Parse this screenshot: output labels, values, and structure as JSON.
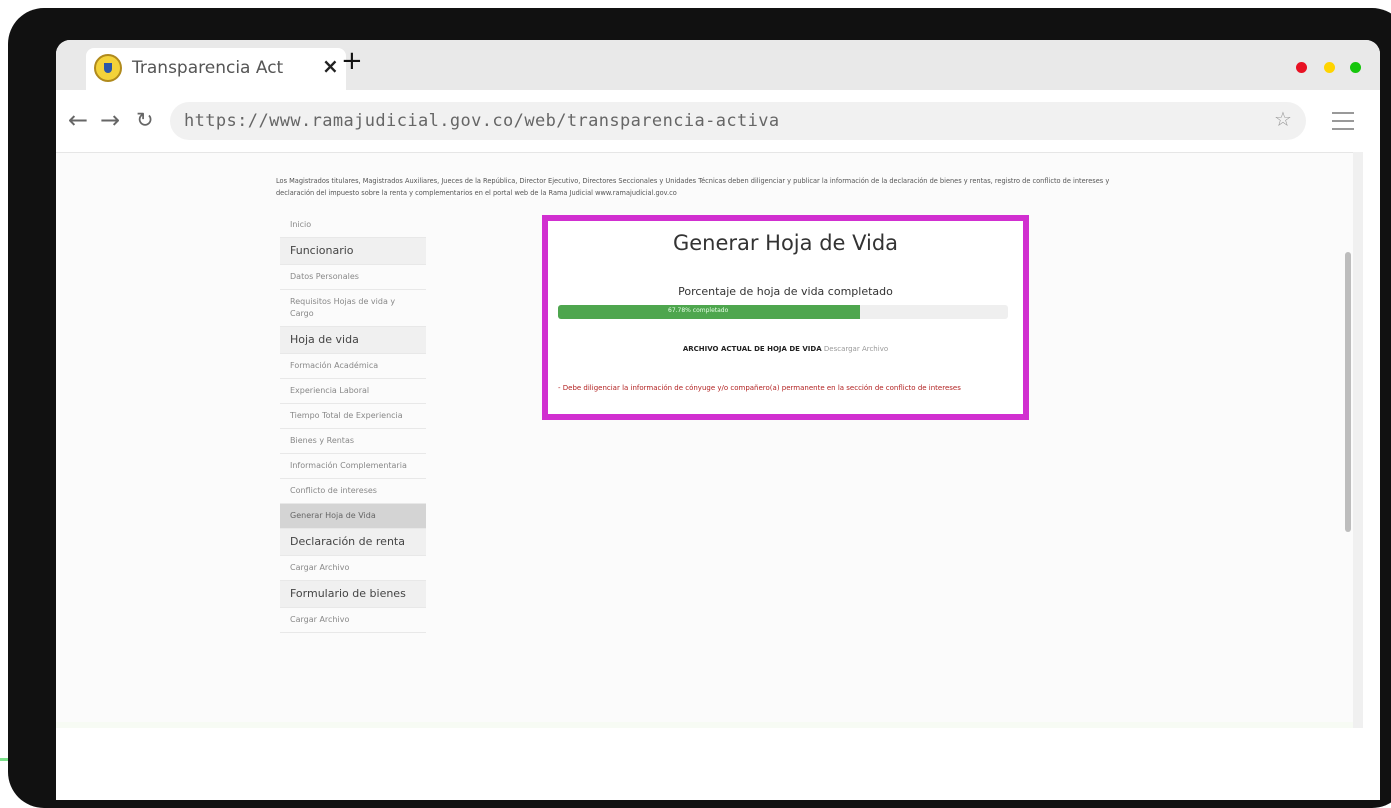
{
  "browser": {
    "tab_title": "Transparencia Act",
    "tab_close": "×",
    "new_tab": "+",
    "url": "https://www.ramajudicial.gov.co/web/transparencia-activa",
    "window_dots": [
      "#e81123",
      "#ffd400",
      "#16c60c"
    ]
  },
  "page": {
    "intro": "Los Magistrados titulares, Magistrados Auxiliares, Jueces de la República, Director Ejecutivo, Directores Seccionales y Unidades Técnicas deben diligenciar y publicar la información de la declaración de bienes y rentas, registro de conflicto de intereses y declaración del impuesto sobre la renta y complementarios en el portal web de la Rama Judicial www.ramajudicial.gov.co",
    "sidebar": {
      "inicio": "Inicio",
      "funcionario": "Funcionario",
      "datos_personales": "Datos Personales",
      "requisitos": "Requisitos Hojas de vida y Cargo",
      "hoja_de_vida": "Hoja de vida",
      "formacion": "Formación Académica",
      "experiencia": "Experiencia Laboral",
      "tiempo_total": "Tiempo Total de Experiencia",
      "bienes": "Bienes y Rentas",
      "informacion": "Información Complementaria",
      "conflicto": "Conflicto de intereses",
      "generar": "Generar Hoja de Vida",
      "declaracion": "Declaración de renta",
      "cargar_renta": "Cargar Archivo",
      "formulario": "Formulario de bienes",
      "cargar_bienes": "Cargar Archivo"
    },
    "panel": {
      "title": "Generar Hoja de Vida",
      "progress_label": "Porcentaje de hoja de vida completado",
      "progress_percent": 67,
      "progress_text": "67.78% completado",
      "file_label": "ARCHIVO ACTUAL DE HOJA DE VIDA",
      "file_value": "Descargar Archivo",
      "warning": "- Debe diligenciar la información de cónyuge y/o compañero(a) permanente en la sección de conflicto de intereses"
    },
    "highlight_color": "#d12fd0",
    "progress_color": "#4ea64e"
  }
}
